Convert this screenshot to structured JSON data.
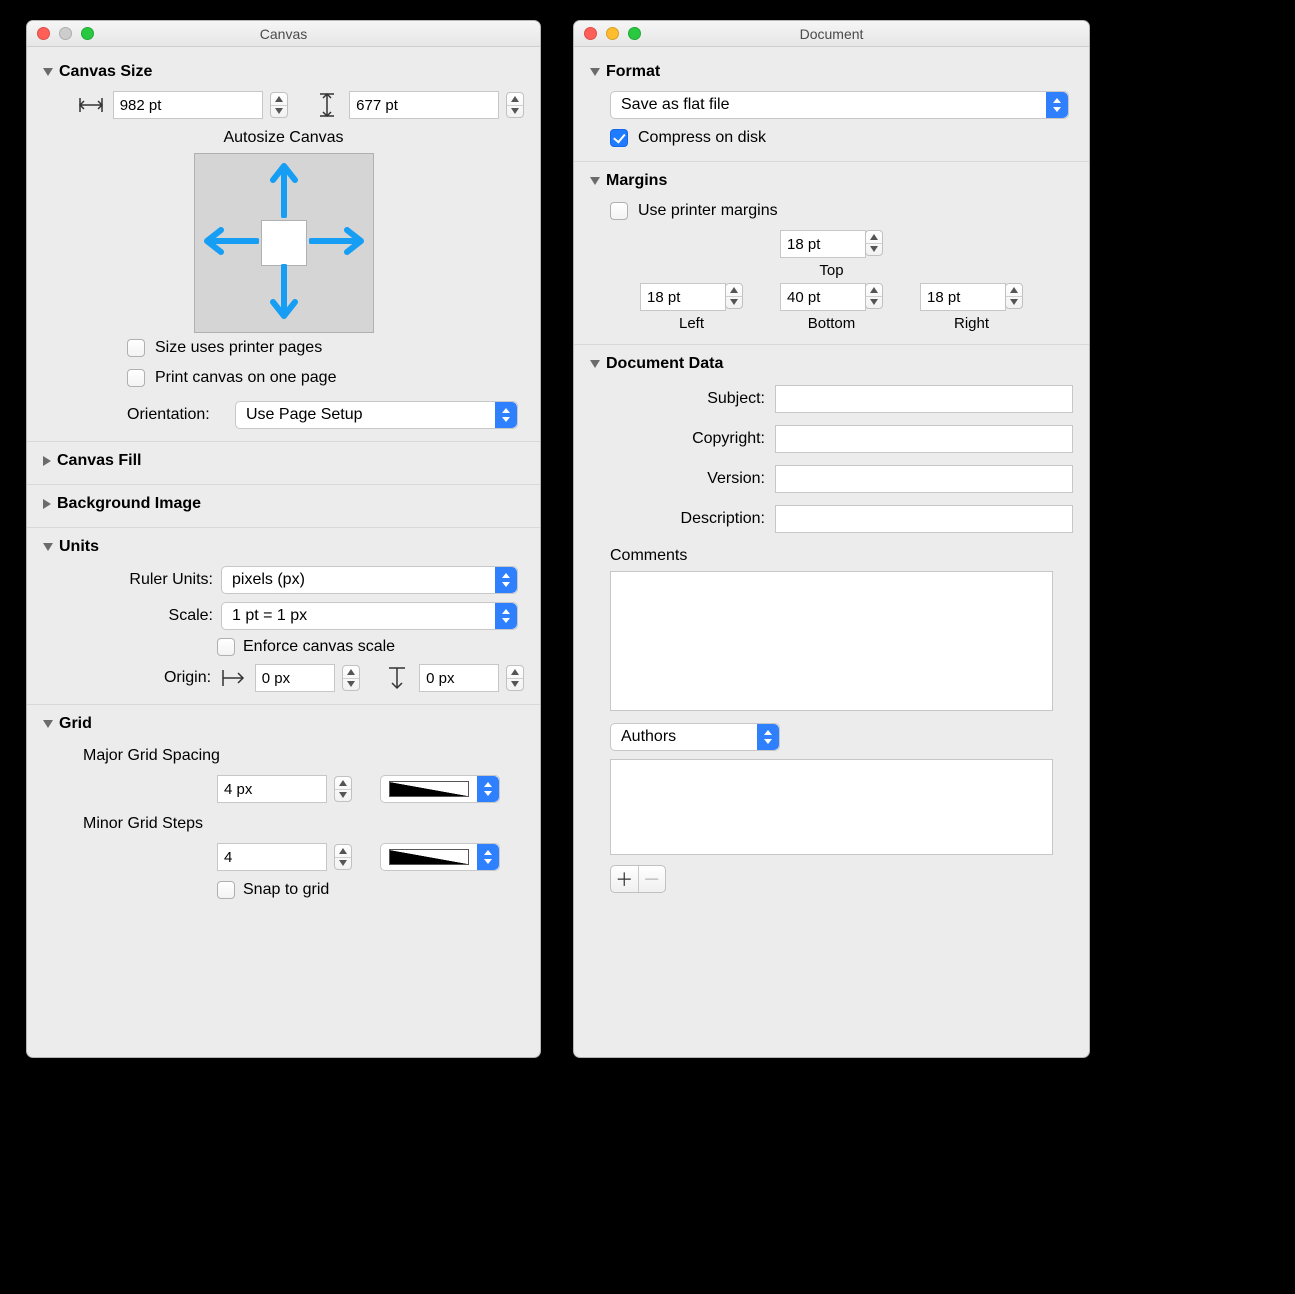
{
  "canvas_window": {
    "title": "Canvas",
    "sections": {
      "canvas_size": {
        "header": "Canvas Size",
        "width_value": "982 pt",
        "height_value": "677 pt",
        "autosize_label": "Autosize Canvas",
        "size_uses_printer_pages": "Size uses printer pages",
        "print_on_one_page": "Print canvas on one page",
        "orientation_label": "Orientation:",
        "orientation_value": "Use Page Setup"
      },
      "canvas_fill": {
        "header": "Canvas Fill"
      },
      "background_image": {
        "header": "Background Image"
      },
      "units": {
        "header": "Units",
        "ruler_units_label": "Ruler Units:",
        "ruler_units_value": "pixels (px)",
        "scale_label": "Scale:",
        "scale_value": "1 pt = 1 px",
        "enforce_label": "Enforce canvas scale",
        "origin_label": "Origin:",
        "origin_x": "0 px",
        "origin_y": "0 px"
      },
      "grid": {
        "header": "Grid",
        "major_label": "Major Grid Spacing",
        "major_value": "4 px",
        "minor_label": "Minor Grid Steps",
        "minor_value": "4",
        "snap_label": "Snap to grid"
      }
    }
  },
  "document_window": {
    "title": "Document",
    "sections": {
      "format": {
        "header": "Format",
        "save_mode": "Save as flat file",
        "compress_label": "Compress on disk"
      },
      "margins": {
        "header": "Margins",
        "use_printer_label": "Use printer margins",
        "top_value": "18 pt",
        "top_label": "Top",
        "left_value": "18 pt",
        "left_label": "Left",
        "right_value": "18 pt",
        "right_label": "Right",
        "bottom_value": "40 pt",
        "bottom_label": "Bottom"
      },
      "doc_data": {
        "header": "Document Data",
        "subject_label": "Subject:",
        "copyright_label": "Copyright:",
        "version_label": "Version:",
        "description_label": "Description:",
        "comments_label": "Comments",
        "authors_select": "Authors"
      }
    }
  }
}
